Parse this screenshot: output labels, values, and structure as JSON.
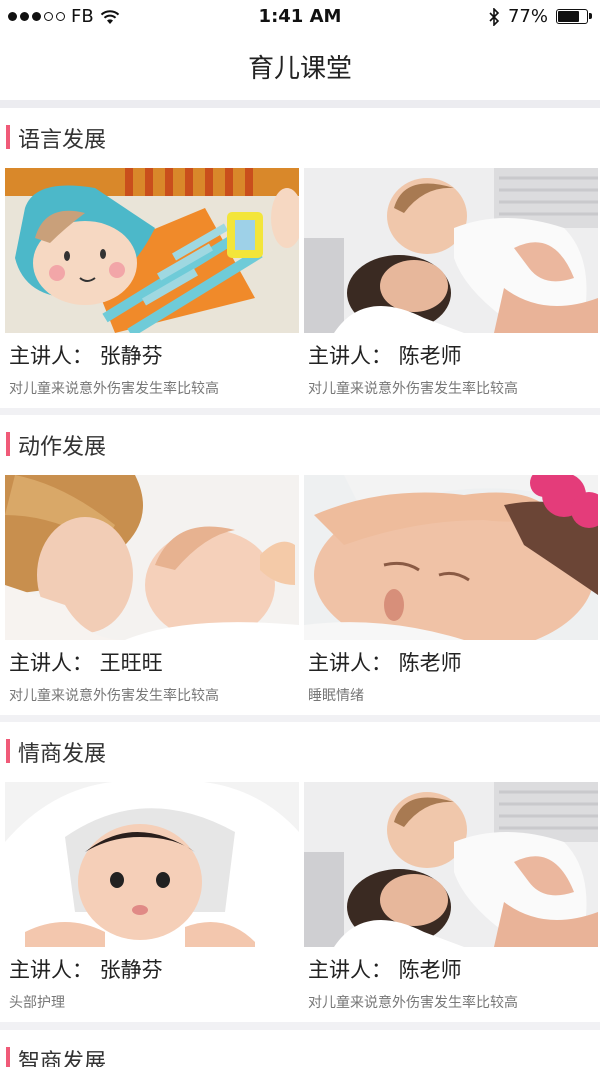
{
  "status_bar": {
    "carrier": "FB",
    "time": "1:41 AM",
    "battery_percent": "77%",
    "battery_level": 0.77
  },
  "nav": {
    "title": "育儿课堂"
  },
  "sections": [
    {
      "title": "语言发展",
      "cards": [
        {
          "lecturer": "主讲人：  张静芬",
          "desc": "对儿童来说意外伤害发生率比较高",
          "image": "felt-cartoon-baby-image"
        },
        {
          "lecturer": "主讲人：  陈老师",
          "desc": "对儿童来说意外伤害发生率比较高",
          "image": "mother-lifting-baby-image"
        }
      ]
    },
    {
      "title": "动作发展",
      "cards": [
        {
          "lecturer": "主讲人：  王旺旺",
          "desc": "对儿童来说意外伤害发生率比较高",
          "image": "mother-baby-sleeping-image"
        },
        {
          "lecturer": "主讲人：  陈老师",
          "desc": "睡眠情绪",
          "image": "sleeping-newborn-image"
        }
      ]
    },
    {
      "title": "情商发展",
      "cards": [
        {
          "lecturer": "主讲人：  张静芬",
          "desc": "头部护理",
          "image": "baby-under-blanket-image"
        },
        {
          "lecturer": "主讲人：  陈老师",
          "desc": "对儿童来说意外伤害发生率比较高",
          "image": "mother-lifting-baby-image"
        }
      ]
    },
    {
      "title": "智商发展",
      "cards": []
    }
  ],
  "colors": {
    "accent": "#f05a78",
    "page_background": "#f1f1f4",
    "card_background": "#ffffff"
  }
}
